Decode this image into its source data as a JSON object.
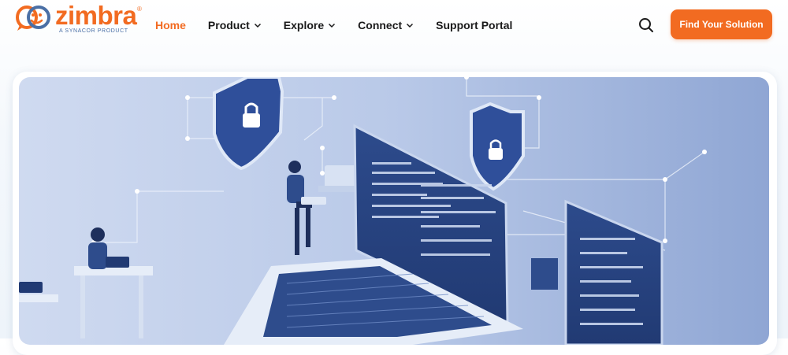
{
  "brand": {
    "name": "zimbra",
    "registered": "®",
    "tagline": "A SYNACOR PRODUCT",
    "primary_color": "#f26b21",
    "secondary_color": "#4a6fa5"
  },
  "nav": {
    "items": [
      {
        "label": "Home",
        "active": true,
        "dropdown": false
      },
      {
        "label": "Product",
        "active": false,
        "dropdown": true
      },
      {
        "label": "Explore",
        "active": false,
        "dropdown": true
      },
      {
        "label": "Connect",
        "active": false,
        "dropdown": true
      },
      {
        "label": "Support Portal",
        "active": false,
        "dropdown": false
      }
    ]
  },
  "search": {
    "icon": "search-icon"
  },
  "cta": {
    "label": "Find Your Solution"
  },
  "hero": {
    "image": "cybersecurity-illustration",
    "colors": {
      "bg": "#b7c8e6",
      "shield": "#2f4f9a",
      "screen": "#27437f"
    }
  }
}
